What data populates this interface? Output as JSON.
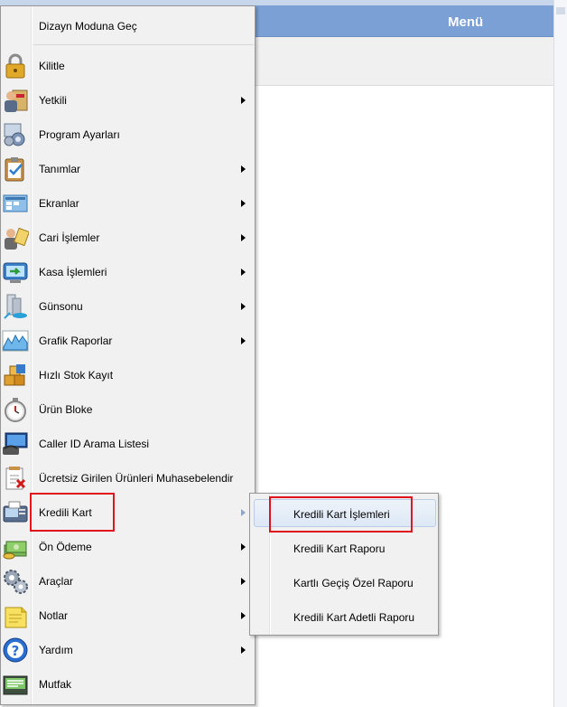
{
  "window": {
    "title": "Menü"
  },
  "menu": {
    "items": [
      {
        "label": "Dizayn Moduna Geç",
        "icon": "design-mode-icon",
        "submenu": false
      },
      {
        "label": "Kilitle",
        "icon": "lock-icon",
        "submenu": false
      },
      {
        "label": "Yetkili",
        "icon": "authorized-users-icon",
        "submenu": true
      },
      {
        "label": "Program Ayarları",
        "icon": "settings-icon",
        "submenu": false
      },
      {
        "label": "Tanımlar",
        "icon": "clipboard-check-icon",
        "submenu": true
      },
      {
        "label": "Ekranlar",
        "icon": "screens-icon",
        "submenu": true
      },
      {
        "label": "Cari İşlemler",
        "icon": "customer-transactions-icon",
        "submenu": true
      },
      {
        "label": "Kasa İşlemleri",
        "icon": "cash-register-icon",
        "submenu": true
      },
      {
        "label": "Günsonu",
        "icon": "end-of-day-icon",
        "submenu": true
      },
      {
        "label": "Grafik Raporlar",
        "icon": "chart-report-icon",
        "submenu": true
      },
      {
        "label": "Hızlı Stok Kayıt",
        "icon": "quick-stock-icon",
        "submenu": false
      },
      {
        "label": "Ürün Bloke",
        "icon": "stopwatch-icon",
        "submenu": false
      },
      {
        "label": "Caller ID Arama Listesi",
        "icon": "caller-id-icon",
        "submenu": false
      },
      {
        "label": "Ücretsiz Girilen Ürünleri Muhasebelendir",
        "icon": "free-products-icon",
        "submenu": false
      },
      {
        "label": "Kredili Kart",
        "icon": "credit-card-icon",
        "submenu": true
      },
      {
        "label": "Ön Ödeme",
        "icon": "money-icon",
        "submenu": true
      },
      {
        "label": "Araçlar",
        "icon": "gears-icon",
        "submenu": true
      },
      {
        "label": "Notlar",
        "icon": "notes-icon",
        "submenu": true
      },
      {
        "label": "Yardım",
        "icon": "help-icon",
        "submenu": true
      },
      {
        "label": "Mutfak",
        "icon": "kitchen-icon",
        "submenu": false
      }
    ]
  },
  "submenu": {
    "items": [
      {
        "label": "Kredili Kart İşlemleri"
      },
      {
        "label": "Kredili Kart Raporu"
      },
      {
        "label": "Kartlı Geçiş Özel Raporu"
      },
      {
        "label": "Kredili Kart Adetli Raporu"
      }
    ]
  },
  "colors": {
    "titlebar": "#7aa0d6",
    "highlight_box": "#e0121c",
    "menu_bg": "#f1f1f1"
  }
}
